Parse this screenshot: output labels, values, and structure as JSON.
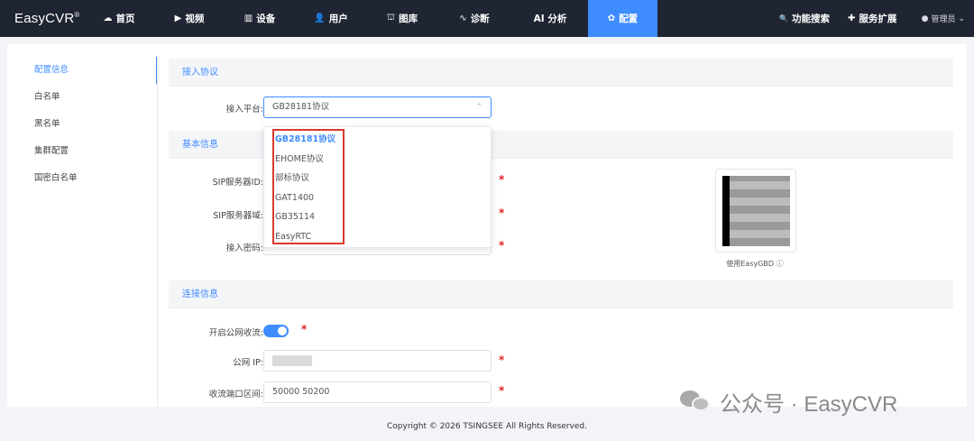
{
  "brand": {
    "name": "EasyCVR",
    "mark": "®"
  },
  "nav": [
    {
      "label": "首页",
      "icon": "dashboard-icon",
      "glyph": "☁"
    },
    {
      "label": "视频",
      "icon": "play-icon",
      "glyph": "▶"
    },
    {
      "label": "设备",
      "icon": "device-icon",
      "glyph": "▥"
    },
    {
      "label": "用户",
      "icon": "user-icon",
      "glyph": "👤"
    },
    {
      "label": "图库",
      "icon": "gallery-icon",
      "glyph": "⛫"
    },
    {
      "label": "诊断",
      "icon": "pulse-icon",
      "glyph": "∿"
    },
    {
      "label": "AI 分析",
      "icon": "",
      "glyph": ""
    },
    {
      "label": "配置",
      "icon": "gear-icon",
      "glyph": "✿"
    }
  ],
  "nav_right": [
    {
      "label": "功能搜索",
      "icon": "search-icon",
      "glyph": "🔍"
    },
    {
      "label": "服务扩展",
      "icon": "puzzle-icon",
      "glyph": "✚"
    }
  ],
  "admin": {
    "label": "管理员",
    "chevron": "⌄"
  },
  "sidebar": [
    "配置信息",
    "白名单",
    "黑名单",
    "集群配置",
    "国密白名单"
  ],
  "sections": {
    "access": "接入协议",
    "basic": "基本信息",
    "connect": "连接信息"
  },
  "form": {
    "platform_label": "接入平台:",
    "platform_value": "GB28181协议",
    "sip_id_label": "SIP服务器ID:",
    "sip_domain_label": "SIP服务器域:",
    "password_label": "接入密码:",
    "public_stream_label": "开启公网收流:",
    "public_ip_label": "公网 IP:",
    "port_range_label": "收流端口区间:",
    "port_range_value": "50000 50200",
    "required_mark": "*"
  },
  "dropdown_options": [
    "GB28181协议",
    "EHOME协议",
    "部标协议",
    "GAT1400",
    "GB35114",
    "EasyRTC"
  ],
  "qr_caption": "使用EasyGBD ⓘ",
  "footer": "Copyright © 2026 TSINGSEE All Rights Reserved.",
  "watermark": "公众号 · EasyCVR",
  "colors": {
    "accent": "#3f8cff",
    "nav_bg": "#1f2532",
    "required": "#e02020",
    "highlight_box": "#d9392e"
  }
}
